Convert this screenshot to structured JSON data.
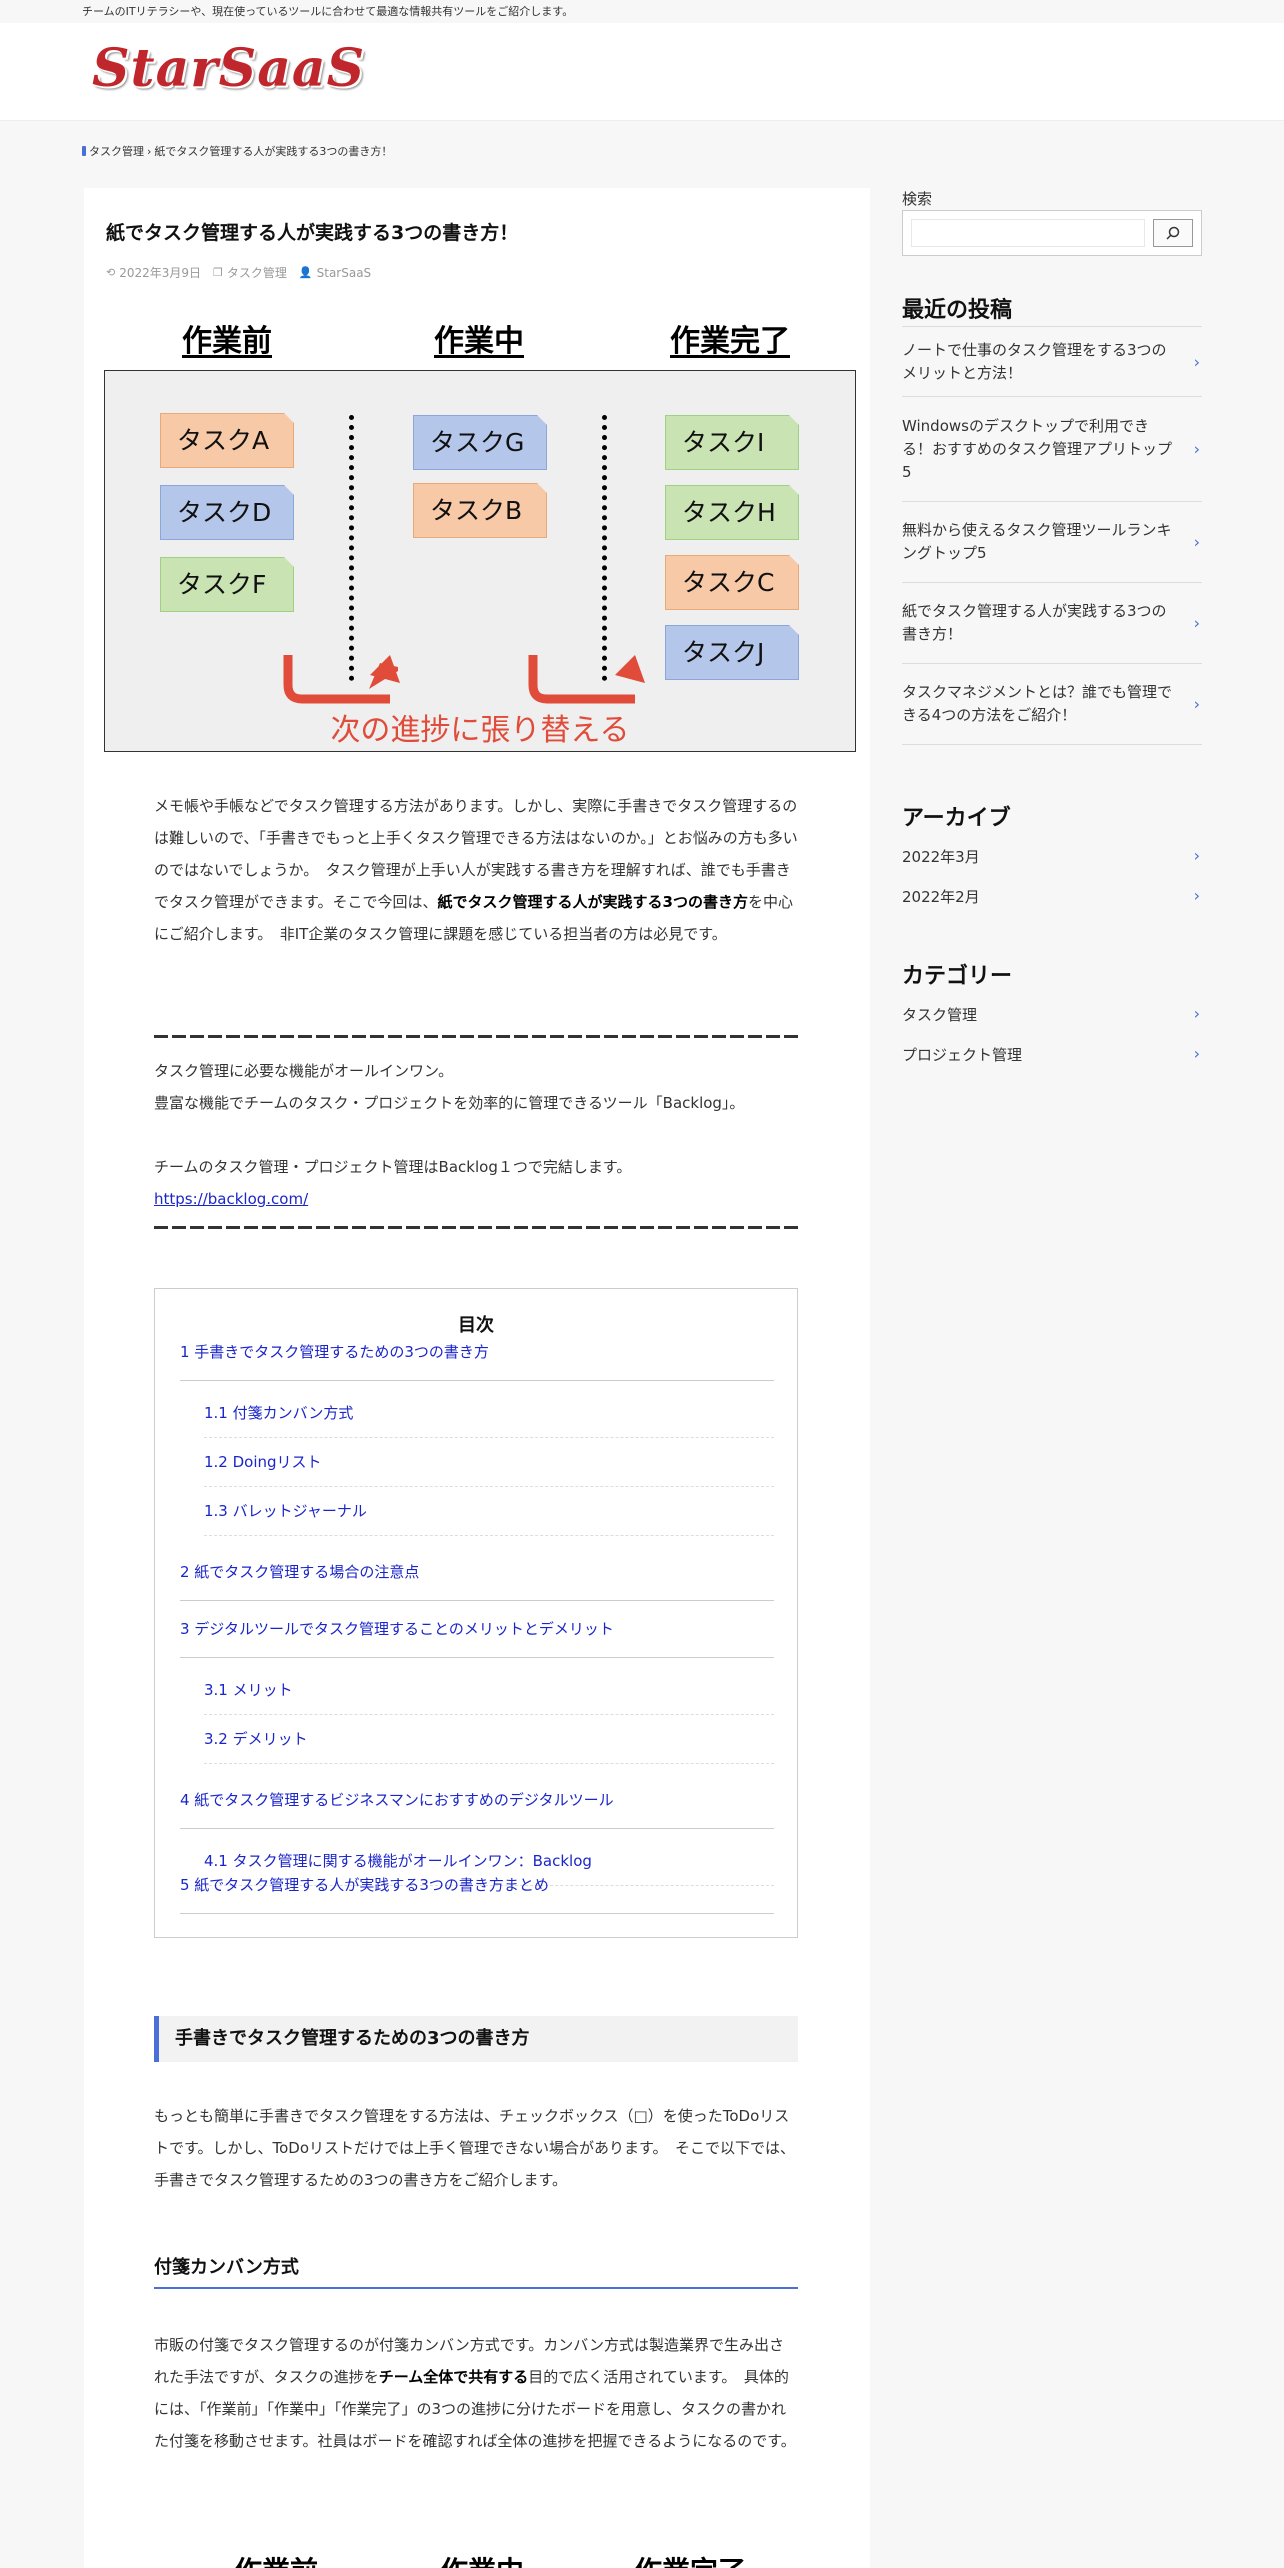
{
  "topbar": {
    "tagline": "チームのITリテラシーや、現在使っているツールに合わせて最適な情報共有ツールをご紹介します。"
  },
  "header": {
    "logo": "StarSaaS"
  },
  "breadcrumb": {
    "items": [
      "タスク管理",
      "紙でタスク管理する人が実践する3つの書き方！"
    ],
    "separator": "›"
  },
  "article": {
    "title": "紙でタスク管理する人が実践する3つの書き方！",
    "date": "2022年3月9日",
    "category": "タスク管理",
    "author": "StarSaaS",
    "figure": {
      "columns": [
        "作業前",
        "作業中",
        "作業完了"
      ],
      "cards_col1": [
        "タスクA",
        "タスクD",
        "タスクF"
      ],
      "cards_col2": [
        "タスクG",
        "タスクB"
      ],
      "cards_col3": [
        "タスクI",
        "タスクH",
        "タスクC",
        "タスクJ"
      ],
      "banner": "次の進捗に張り替える"
    },
    "intro_1": "メモ帳や手帳などでタスク管理する方法があります。しかし、実際に手書きでタスク管理するのは難しいので、「手書きでもっと上手くタスク管理できる方法はないのか。」とお悩みの方も多いのではないでしょうか。　タスク管理が上手い人が実践する書き方を理解すれば、誰でも手書きでタスク管理ができます。そこで今回は、",
    "intro_bold": "紙でタスク管理する人が実践する3つの書き方",
    "intro_2": "を中心にご紹介します。　非IT企業のタスク管理に課題を感じている担当者の方は必見です。",
    "promo_1": "タスク管理に必要な機能がオールインワン。",
    "promo_2": "豊富な機能でチームのタスク・プロジェクトを効率的に管理できるツール「Backlog」。",
    "promo_3": "チームのタスク管理・プロジェクト管理はBacklog１つで完結します。",
    "promo_link": "https://backlog.com/",
    "toc": {
      "title": "目次",
      "items": [
        "1  手書きでタスク管理するための3つの書き方",
        "1.1  付箋カンバン方式",
        "1.2  Doingリスト",
        "1.3  バレットジャーナル",
        "2  紙でタスク管理する場合の注意点",
        "3  デジタルツールでタスク管理することのメリットとデメリット",
        "3.1  メリット",
        "3.2  デメリット",
        "4  紙でタスク管理するビジネスマンにおすすめのデジタルツール",
        "4.1  タスク管理に関する機能がオールインワン：Backlog",
        "5  紙でタスク管理する人が実践する3つの書き方まとめ"
      ]
    },
    "h2": "手書きでタスク管理するための3つの書き方",
    "p2": "もっとも簡単に手書きでタスク管理をする方法は、チェックボックス（□）を使ったToDoリストです。しかし、ToDoリストだけでは上手く管理できない場合があります。　そこで以下では、手書きでタスク管理するための3つの書き方をご紹介します。",
    "h3": "付箋カンバン方式",
    "p3_1": "市販の付箋でタスク管理するのが付箋カンバン方式です。カンバン方式は製造業界で生み出された手法ですが、タスクの進捗を",
    "p3_bold": "チーム全体で共有する",
    "p3_2": "目的で広く活用されています。　具体的には、「作業前」「作業中」「作業完了」の3つの進捗に分けたボードを用意し、タスクの書かれた付箋を移動させます。社員はボードを確認すれば全体の進捗を把握できるようになるのです。",
    "figure2_columns": [
      "作業前",
      "作業中",
      "作業完了"
    ]
  },
  "sidebar": {
    "search_label": "検索",
    "search_placeholder": "",
    "recent_title": "最近の投稿",
    "recent": [
      "ノートで仕事のタスク管理をする3つのメリットと方法！",
      "Windowsのデスクトップで利用できる！おすすめのタスク管理アプリトップ5",
      "無料から使えるタスク管理ツールランキングトップ5",
      "紙でタスク管理する人が実践する3つの書き方！",
      "タスクマネジメントとは？誰でも管理できる4つの方法をご紹介！"
    ],
    "archive_title": "アーカイブ",
    "archives": [
      "2022年3月",
      "2022年2月"
    ],
    "category_title": "カテゴリー",
    "categories": [
      "タスク管理",
      "プロジェクト管理"
    ]
  },
  "colors": {
    "accent": "#4a6fd8",
    "link": "#1b26c9",
    "logo": "#c0272d",
    "banner_red": "#e04b3a"
  }
}
